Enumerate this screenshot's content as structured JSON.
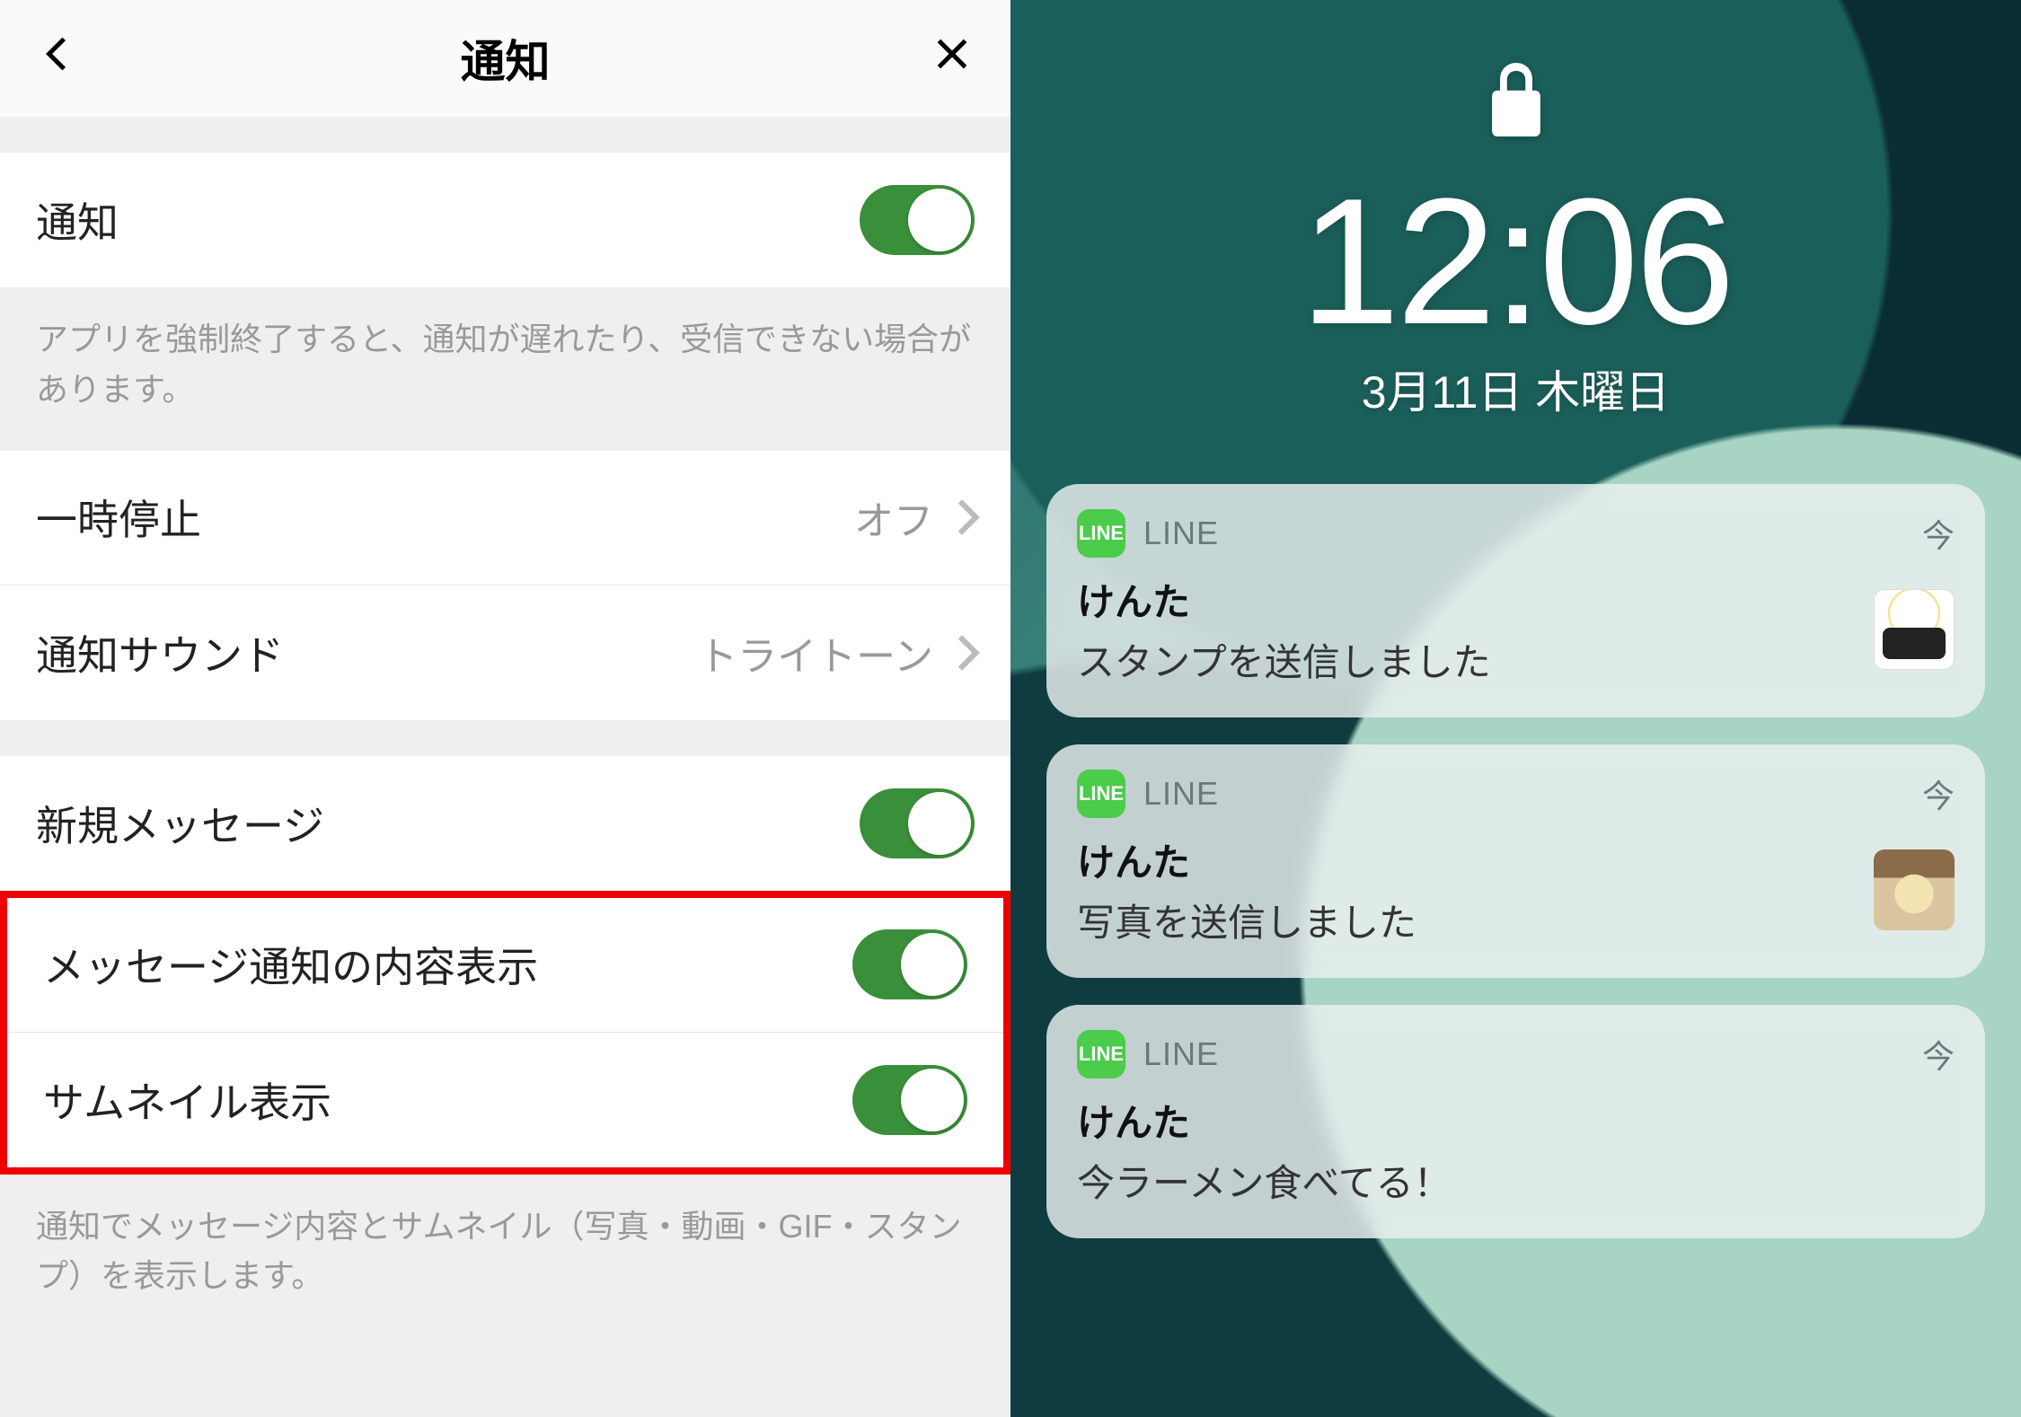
{
  "settings": {
    "title": "通知",
    "rows": {
      "notifications": {
        "label": "通知"
      },
      "desc1": "アプリを強制終了すると、通知が遅れたり、受信できない場合があります。",
      "pause": {
        "label": "一時停止",
        "value": "オフ"
      },
      "sound": {
        "label": "通知サウンド",
        "value": "トライトーン"
      },
      "new_message": {
        "label": "新規メッセージ"
      },
      "content_preview": {
        "label": "メッセージ通知の内容表示"
      },
      "thumbnail": {
        "label": "サムネイル表示"
      },
      "desc2": "通知でメッセージ内容とサムネイル（写真・動画・GIF・スタンプ）を表示します。"
    }
  },
  "lockscreen": {
    "time": "12:06",
    "date": "3月11日 木曜日",
    "notifications": [
      {
        "app": "LINE",
        "time": "今",
        "sender": "けんた",
        "message": "スタンプを送信しました",
        "thumb": "sticker"
      },
      {
        "app": "LINE",
        "time": "今",
        "sender": "けんた",
        "message": "写真を送信しました",
        "thumb": "photo"
      },
      {
        "app": "LINE",
        "time": "今",
        "sender": "けんた",
        "message": "今ラーメン食べてる！",
        "thumb": ""
      }
    ],
    "app_icon_text": "LINE"
  }
}
